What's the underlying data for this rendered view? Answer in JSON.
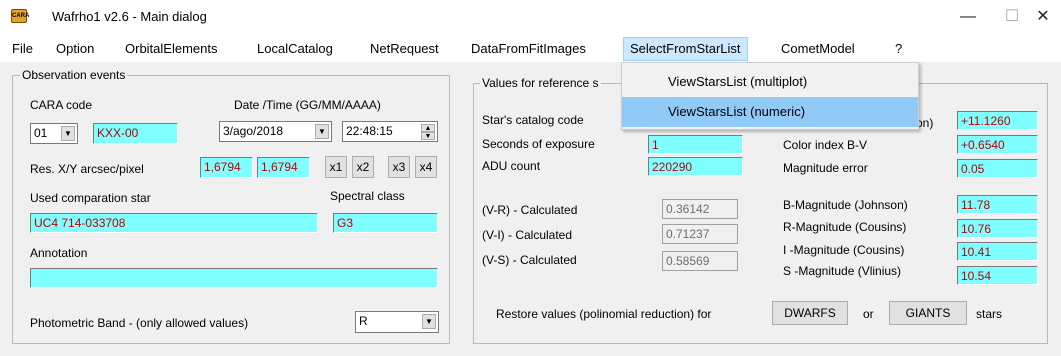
{
  "window": {
    "app_icon_text": "CARA",
    "title": "Wafrho1 v2.6 - Main dialog",
    "minimize": "—",
    "maximize": "☐",
    "close": "✕"
  },
  "menu": [
    "File",
    "Option",
    "OrbitalElements",
    "LocalCatalog",
    "NetRequest",
    "DataFromFitImages",
    "SelectFromStarList",
    "CometModel",
    "?"
  ],
  "dropdown": [
    "ViewStarsList (multiplot)",
    "ViewStarsList (numeric)"
  ],
  "obs": {
    "legend": "Observation events",
    "cara_code_label": "CARA code",
    "cara_code_value": "01",
    "cara_code_field": "KXX-00",
    "datetime_label": "Date /Time  (GG/MM/AAAA)",
    "date_value": "3/ago/2018",
    "time_value": "22:48:15",
    "res_label": "Res. X/Y arcsec/pixel",
    "res_x": "1,6794",
    "res_y": "1,6794",
    "zoom_buttons": [
      "x1",
      "x2",
      "x3",
      "x4"
    ],
    "comp_star_label": "Used comparation star",
    "comp_star_value": "UC4 714-033708",
    "spectral_label": "Spectral class",
    "spectral_value": "G3",
    "annotation_label": "Annotation",
    "annotation_value": "",
    "band_label": "Photometric Band  - (only allowed values)",
    "band_value": "R"
  },
  "ref": {
    "legend": "Values for reference s",
    "catalog_label": "Star's catalog code",
    "seconds_label": "Seconds of exposure",
    "seconds_value": "1",
    "adu_label": "ADU count",
    "adu_value": "220290",
    "vr_label": "(V-R) - Calculated",
    "vr_value": "0.36142",
    "vi_label": "(V-I) -  Calculated",
    "vi_value": "0.71237",
    "vs_label": "(V-S) - Calculated",
    "vs_value": "0.58569",
    "vmag_label_tail": "on)",
    "vmag_value": "+11.1260",
    "color_index_label": "Color index B-V",
    "color_index_value": "+0.6540",
    "mag_error_label": "Magnitude error",
    "mag_error_value": "0.05",
    "bmag_label": "B-Magnitude (Johnson)",
    "bmag_value": "11.78",
    "rmag_label": "R-Magnitude (Cousins)",
    "rmag_value": "10.76",
    "imag_label": "I -Magnitude (Cousins)",
    "imag_value": "10.41",
    "smag_label": "S -Magnitude (Vlinius)",
    "smag_value": "10.54",
    "restore_label": "Restore values (polinomial reduction) for",
    "dwarfs_button": "DWARFS",
    "or_label": "or",
    "giants_button": "GIANTS",
    "stars_label": "stars"
  }
}
